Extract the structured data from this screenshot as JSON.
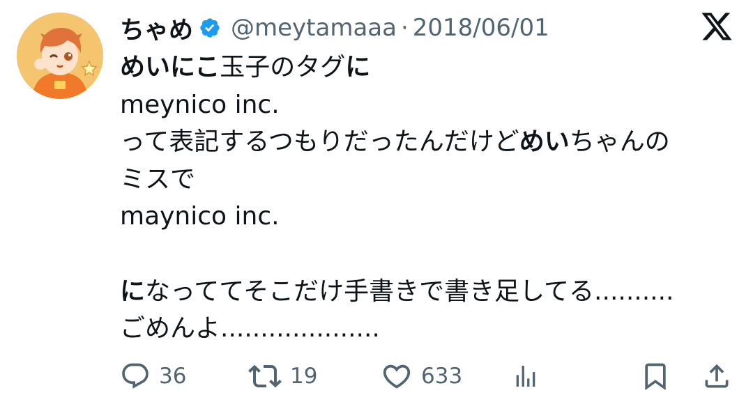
{
  "user": {
    "display_name": "ちゃめ",
    "handle": "@meytamaaa",
    "separator": "·",
    "date": "2018/06/01"
  },
  "tweet": {
    "line1": [
      "めいにこ",
      "玉子のタグ",
      "に"
    ],
    "line2": "meynico inc.",
    "line3": [
      "って表記するつもりだったんだけど",
      "めい",
      "ちゃんの"
    ],
    "line4": "ミスで",
    "line5": "maynico inc.",
    "line7": [
      "に",
      "なっててそこだけ手書きで書き足してる.........."
    ],
    "line8": "ごめんよ...................."
  },
  "actions": {
    "replies": "36",
    "retweets": "19",
    "likes": "633"
  },
  "icons": {
    "verified": "verified-badge-icon",
    "platform": "x-logo-icon",
    "reply": "reply-icon",
    "retweet": "retweet-icon",
    "like": "heart-icon",
    "views": "analytics-icon",
    "bookmark": "bookmark-icon",
    "share": "share-icon"
  },
  "colors": {
    "text": "#0f1419",
    "secondary": "#536471",
    "verified": "#1d9bf0",
    "avatar_bg": "#f3c26a"
  }
}
